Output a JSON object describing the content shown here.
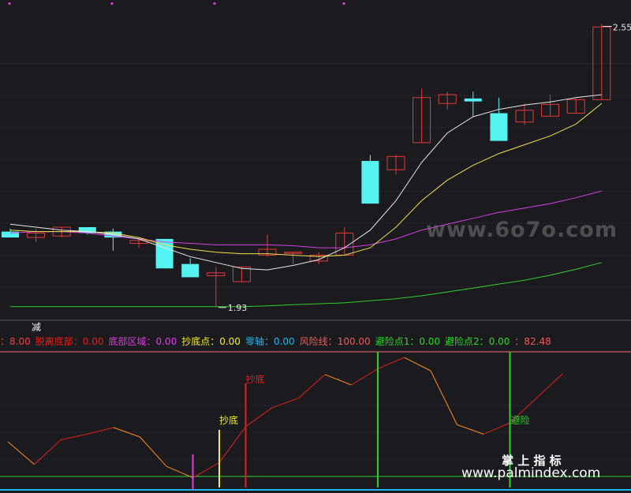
{
  "chart_data": [
    {
      "type": "candlestick",
      "candles": [
        {
          "o": 2.185,
          "h": 2.195,
          "l": 2.165,
          "c": 2.165
        },
        {
          "o": 2.165,
          "h": 2.195,
          "l": 2.15,
          "c": 2.18
        },
        {
          "o": 2.17,
          "h": 2.2,
          "l": 2.165,
          "c": 2.2
        },
        {
          "o": 2.2,
          "h": 2.2,
          "l": 2.175,
          "c": 2.18
        },
        {
          "o": 2.185,
          "h": 2.195,
          "l": 2.12,
          "c": 2.165
        },
        {
          "o": 2.145,
          "h": 2.165,
          "l": 2.13,
          "c": 2.155
        },
        {
          "o": 2.16,
          "h": 2.16,
          "l": 2.06,
          "c": 2.06
        },
        {
          "o": 2.075,
          "h": 2.095,
          "l": 2.03,
          "c": 2.03
        },
        {
          "o": 2.035,
          "h": 2.065,
          "l": 1.93,
          "c": 2.045
        },
        {
          "o": 2.015,
          "h": 2.065,
          "l": 2.015,
          "c": 2.065
        },
        {
          "o": 2.105,
          "h": 2.175,
          "l": 2.1,
          "c": 2.125
        },
        {
          "o": 2.115,
          "h": 2.115,
          "l": 2.075,
          "c": 2.115
        },
        {
          "o": 2.085,
          "h": 2.115,
          "l": 2.075,
          "c": 2.105
        },
        {
          "o": 2.105,
          "h": 2.2,
          "l": 2.105,
          "c": 2.18
        },
        {
          "o": 2.425,
          "h": 2.445,
          "l": 2.28,
          "c": 2.28
        },
        {
          "o": 2.395,
          "h": 2.445,
          "l": 2.38,
          "c": 2.44
        },
        {
          "o": 2.487,
          "h": 2.67,
          "l": 2.487,
          "c": 2.64
        },
        {
          "o": 2.62,
          "h": 2.66,
          "l": 2.6,
          "c": 2.65
        },
        {
          "o": 2.637,
          "h": 2.66,
          "l": 2.577,
          "c": 2.627
        },
        {
          "o": 2.587,
          "h": 2.64,
          "l": 2.493,
          "c": 2.493
        },
        {
          "o": 2.557,
          "h": 2.62,
          "l": 2.547,
          "c": 2.597
        },
        {
          "o": 2.577,
          "h": 2.65,
          "l": 2.577,
          "c": 2.617
        },
        {
          "o": 2.587,
          "h": 2.637,
          "l": 2.587,
          "c": 2.633
        },
        {
          "o": 2.633,
          "h": 2.89,
          "l": 2.633,
          "c": 2.88
        }
      ],
      "ma_white": [
        2.21,
        2.2,
        2.19,
        2.185,
        2.175,
        2.16,
        2.13,
        2.1,
        2.08,
        2.06,
        2.055,
        2.07,
        2.09,
        2.13,
        2.19,
        2.29,
        2.42,
        2.52,
        2.575,
        2.6,
        2.615,
        2.625,
        2.64,
        2.65
      ],
      "ma_yellow": [
        2.19,
        2.185,
        2.185,
        2.185,
        2.18,
        2.165,
        2.14,
        2.125,
        2.115,
        2.11,
        2.11,
        2.105,
        2.1,
        2.105,
        2.13,
        2.2,
        2.29,
        2.36,
        2.41,
        2.45,
        2.48,
        2.51,
        2.55,
        2.62
      ],
      "ma_magenta": [
        2.18,
        2.185,
        2.185,
        2.18,
        2.17,
        2.16,
        2.15,
        2.145,
        2.14,
        2.14,
        2.14,
        2.137,
        2.13,
        2.13,
        2.14,
        2.16,
        2.19,
        2.21,
        2.23,
        2.25,
        2.265,
        2.28,
        2.3,
        2.323
      ],
      "ma_green": [
        1.93,
        1.93,
        1.93,
        1.93,
        1.93,
        1.93,
        1.93,
        1.93,
        1.93,
        1.93,
        1.933,
        1.937,
        1.94,
        1.943,
        1.95,
        1.957,
        1.967,
        1.98,
        1.993,
        2.007,
        2.02,
        2.037,
        2.057,
        2.08
      ],
      "annotations": {
        "high_label": "2.55",
        "low_label": "1.93"
      }
    },
    {
      "type": "line",
      "values": [
        50,
        26,
        52,
        58,
        65,
        55,
        24,
        12,
        28,
        66,
        86,
        96,
        121,
        110,
        127,
        139,
        125,
        68,
        58,
        70,
        96,
        122
      ],
      "signals": {
        "bottom_region_bar_index": 7,
        "bottom_signal_bar_index": 8,
        "bottom_signal_label": "抄底",
        "bottom_signal2_bar_index": 9,
        "bottom_signal2_label": "抄底",
        "escape_bar_indices": [
          14,
          19
        ],
        "escape_label": "避险"
      }
    }
  ],
  "toolbar": {
    "jian_label": "减",
    "params": [
      {
        "label": "：",
        "value": "8.00",
        "color": "#ff3a3a"
      },
      {
        "label": "脱离底部：",
        "value": "0.00",
        "color": "#e02020"
      },
      {
        "label": "底部区域：",
        "value": "0.00",
        "color": "#e03ae0"
      },
      {
        "label": "抄底点：",
        "value": "0.00",
        "color": "#f4ee2a"
      },
      {
        "label": "零轴：",
        "value": "0.00",
        "color": "#22b8f0"
      },
      {
        "label": "风险线：",
        "value": "100.00",
        "color": "#f05a5a"
      },
      {
        "label": "避险点1：",
        "value": "0.00",
        "color": "#2bd92b"
      },
      {
        "label": "避险点2：",
        "value": "0.00",
        "color": "#2bd92b"
      },
      {
        "label": "：",
        "value": "82.48",
        "color": "#f05a5a"
      }
    ]
  },
  "watermarks": {
    "site1": "www.6o7o.com",
    "brand": "掌 上 指 标",
    "site2": "www.palmindex.com"
  },
  "colors": {
    "bg": "#1b1b1f",
    "up": "#e03a3a",
    "down": "#55f2f2",
    "ma_white": "#e8e8e8",
    "ma_yellow": "#f2e24a",
    "ma_magenta": "#d640e6",
    "ma_green": "#2fd12f",
    "osc": "#ff8c1a"
  }
}
